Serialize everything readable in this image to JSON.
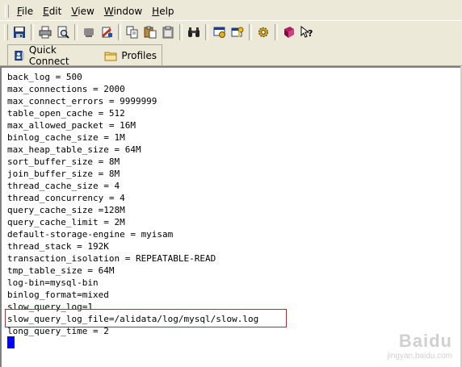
{
  "menubar": {
    "items": [
      {
        "label": "File",
        "accel": "F",
        "rest": "ile"
      },
      {
        "label": "Edit",
        "accel": "E",
        "rest": "dit"
      },
      {
        "label": "View",
        "accel": "V",
        "rest": "iew"
      },
      {
        "label": "Window",
        "accel": "W",
        "rest": "indow"
      },
      {
        "label": "Help",
        "accel": "H",
        "rest": "elp"
      }
    ]
  },
  "toolbar": {
    "icons": [
      "save-icon",
      "print-icon",
      "print-preview-icon",
      "disconnect-icon",
      "new-file-icon",
      "copy-icon",
      "paste-icon",
      "clipboard-icon",
      "find-icon",
      "settings-icon",
      "key-icon",
      "gear-icon",
      "help-book-icon",
      "context-help-icon"
    ]
  },
  "connectbar": {
    "quick_connect_label": "Quick Connect",
    "profiles_label": "Profiles"
  },
  "editor": {
    "lines": [
      "back_log = 500",
      "max_connections = 2000",
      "max_connect_errors = 9999999",
      "table_open_cache = 512",
      "max_allowed_packet = 16M",
      "binlog_cache_size = 1M",
      "max_heap_table_size = 64M",
      "sort_buffer_size = 8M",
      "join_buffer_size = 8M",
      "thread_cache_size = 4",
      "thread_concurrency = 4",
      "query_cache_size =128M",
      "query_cache_limit = 2M",
      "default-storage-engine = myisam",
      "thread_stack = 192K",
      "transaction_isolation = REPEATABLE-READ",
      "tmp_table_size = 64M",
      "log-bin=mysql-bin",
      "binlog_format=mixed",
      "slow_query_log=1",
      "slow_query_log_file=/alidata/log/mysql/slow.log",
      "long_query_time = 2"
    ],
    "highlight_color": "#d02020",
    "cursor_color": "#0000ff"
  },
  "watermark": {
    "logo": "Baidu",
    "site": "jingyan.baidu.com"
  }
}
